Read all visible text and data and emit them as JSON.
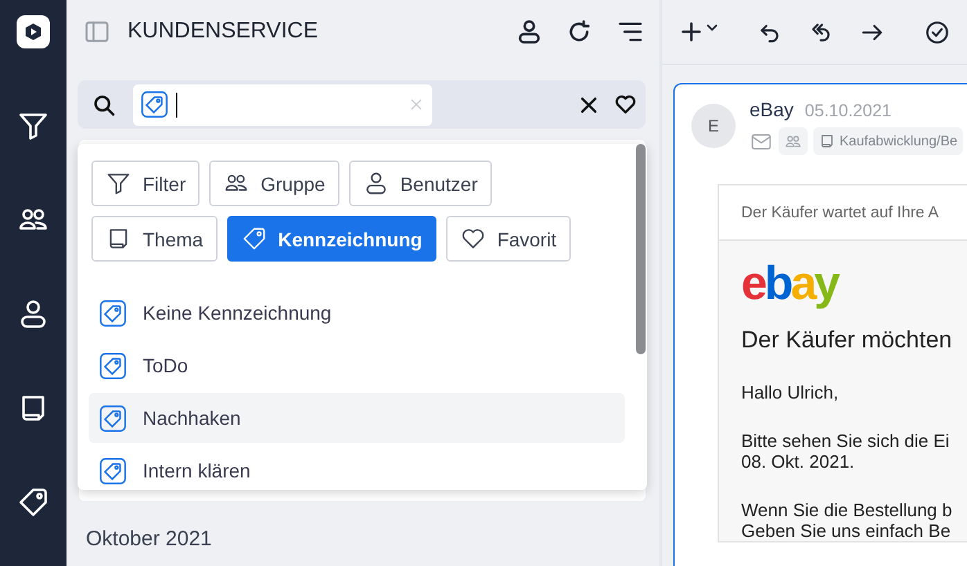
{
  "panel": {
    "title": "KUNDENSERVICE"
  },
  "filter_chips": [
    {
      "label": "Filter",
      "kind": "filter",
      "selected": false
    },
    {
      "label": "Gruppe",
      "kind": "group",
      "selected": false
    },
    {
      "label": "Benutzer",
      "kind": "user",
      "selected": false
    },
    {
      "label": "Thema",
      "kind": "topic",
      "selected": false
    },
    {
      "label": "Kennzeichnung",
      "kind": "tag",
      "selected": true
    },
    {
      "label": "Favorit",
      "kind": "favorite",
      "selected": false
    }
  ],
  "options": [
    {
      "label": "Keine Kennzeichnung",
      "highlighted": false
    },
    {
      "label": "ToDo",
      "highlighted": false
    },
    {
      "label": "Nachhaken",
      "highlighted": true
    },
    {
      "label": "Intern klären",
      "highlighted": false
    }
  ],
  "month_header": "Oktober 2021",
  "mail": {
    "avatar": "E",
    "sender": "eBay",
    "date": "05.10.2021",
    "category": "Kaufabwicklung/Be",
    "preheader": "Der Käufer wartet auf Ihre A",
    "logo": "ebay",
    "heading": "Der Käufer möchten",
    "paragraphs": [
      [
        "Hallo Ulrich,"
      ],
      [
        "Bitte sehen Sie sich die Ei",
        "08. Okt. 2021."
      ],
      [
        "Wenn Sie die Bestellung b",
        "Geben Sie uns einfach Be"
      ]
    ]
  }
}
